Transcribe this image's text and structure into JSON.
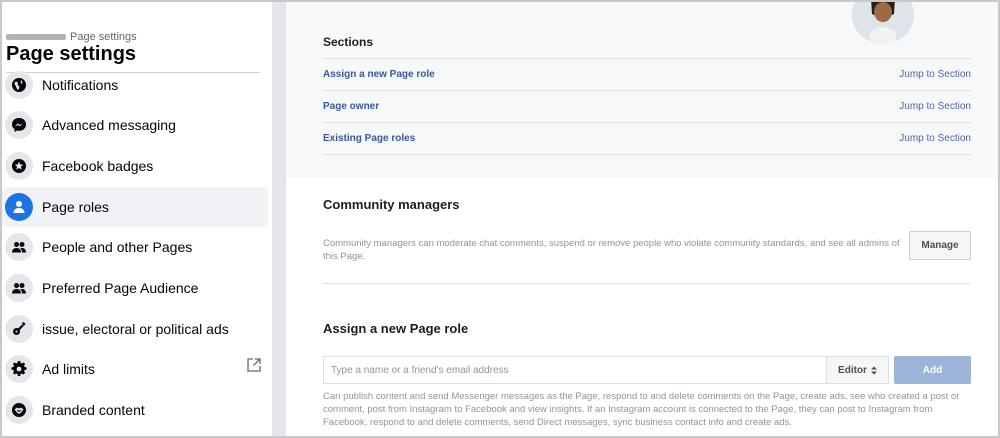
{
  "sidebar": {
    "breadcrumb": "Page settings",
    "title": "Page settings",
    "items": [
      {
        "label": "Notifications",
        "icon": "globe-icon"
      },
      {
        "label": "Advanced messaging",
        "icon": "messenger-icon"
      },
      {
        "label": "Facebook badges",
        "icon": "star-badge-icon"
      },
      {
        "label": "Page roles",
        "icon": "person-icon",
        "active": true
      },
      {
        "label": "People and other Pages",
        "icon": "people-icon"
      },
      {
        "label": "Preferred Page Audience",
        "icon": "people-icon"
      },
      {
        "label": "issue, electoral or political ads",
        "icon": "guitar-icon"
      },
      {
        "label": "Ad limits",
        "icon": "gear-icon",
        "external": true
      },
      {
        "label": "Branded content",
        "icon": "handshake-icon"
      }
    ]
  },
  "sections": {
    "heading": "Sections",
    "rows": [
      {
        "label": "Assign a new Page role",
        "jump": "Jump to Section"
      },
      {
        "label": "Page owner",
        "jump": "Jump to Section"
      },
      {
        "label": "Existing Page roles",
        "jump": "Jump to Section"
      }
    ]
  },
  "community": {
    "heading": "Community managers",
    "description": "Community managers can moderate chat comments, suspend or remove people who violate community standards, and see all admins of this Page.",
    "manage_label": "Manage"
  },
  "assign": {
    "heading": "Assign a new Page role",
    "placeholder": "Type a name or a friend's email address",
    "role_value": "Editor",
    "add_label": "Add",
    "description": "Can publish content and send Messenger messages as the Page, respond to and delete comments on the Page, create ads, see who created a post or comment, post from Instagram to Facebook and view insights. If an Instagram account is connected to the Page, they can post to Instagram from Facebook, respond to and delete comments, send Direct messages, sync business contact info and create ads."
  },
  "colors": {
    "accent": "#1b74e4",
    "link": "#385898",
    "add_button": "#9cb4d8"
  }
}
